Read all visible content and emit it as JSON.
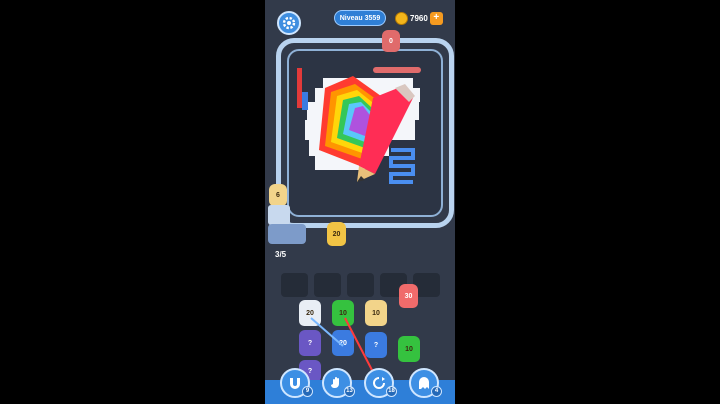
{
  "hud": {
    "level_label": "Niveau 3559",
    "coins": "7960",
    "plus": "+"
  },
  "board": {
    "progress": "3/5",
    "queue_front_count": "6",
    "track_character_count": "20",
    "top_character_count": "0"
  },
  "slots": {
    "total": 5,
    "filled": 0
  },
  "grid_characters": [
    {
      "label": "20",
      "color": "#e9eef5"
    },
    {
      "label": "10",
      "color": "#35c23f"
    },
    {
      "label": "10",
      "color": "#f2d48a"
    },
    {
      "label": "?",
      "color": "#6a57c4"
    },
    {
      "label": "20",
      "color": "#3b7be0"
    },
    {
      "label": "?",
      "color": "#3b7be0"
    },
    {
      "label": "10",
      "color": "#35c23f"
    },
    {
      "label": "?",
      "color": "#6a57c4"
    }
  ],
  "held_character": {
    "label": "30",
    "color": "#f06b6b"
  },
  "boosters": [
    {
      "name": "magnet",
      "count": "9"
    },
    {
      "name": "hand",
      "count": "13"
    },
    {
      "name": "shuffle",
      "count": "18"
    },
    {
      "name": "ghost",
      "count": "4"
    }
  ],
  "colors": {
    "background": "#323a4a",
    "accent": "#3f8ee0",
    "track": "#b9d3ef",
    "coin": "#f3b51b"
  }
}
